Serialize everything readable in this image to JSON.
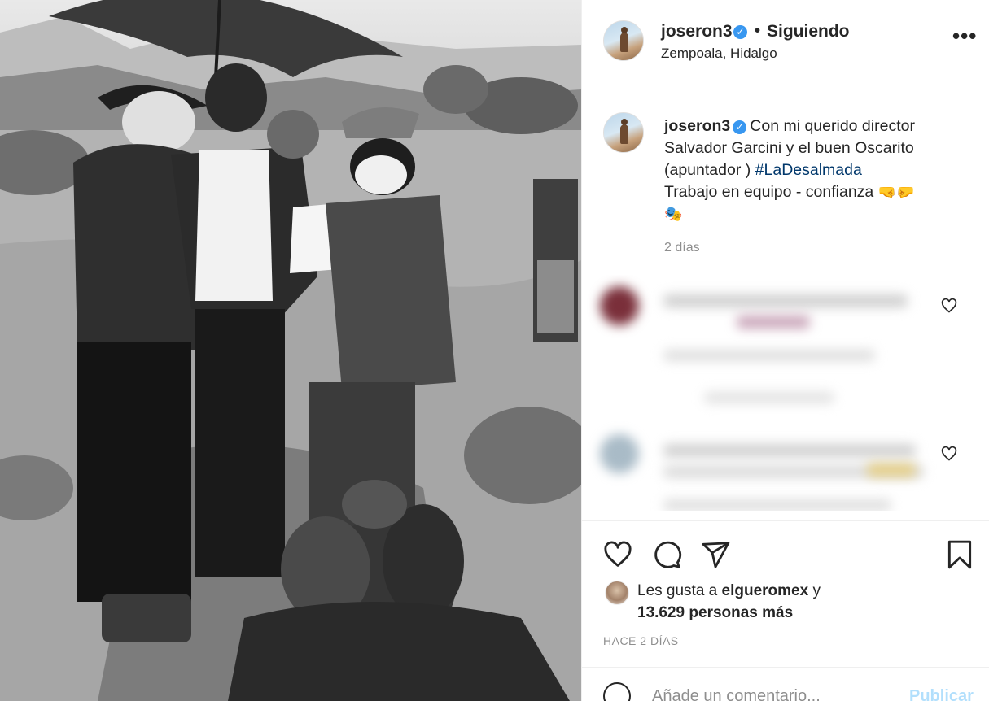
{
  "post": {
    "username": "joseron3",
    "follow_status": "Siguiendo",
    "separator": "•",
    "location": "Zempoala, Hidalgo",
    "more_label": "•••",
    "verified_mark": "✓"
  },
  "caption": {
    "username": "joseron3",
    "text_1": "Con mi querido director Salvador Garcini y el buen Oscarito (apuntador ) ",
    "hashtag": "#LaDesalmada",
    "text_2": "Trabajo en equipo - confianza",
    "emoji_1": "🤜🤛",
    "emoji_2": "🎭",
    "time": "2 días"
  },
  "actions": {
    "icons": [
      "heart-icon",
      "comment-icon",
      "share-icon",
      "bookmark-icon"
    ]
  },
  "likes": {
    "prefix": "Les gusta a ",
    "user": "elgueromex",
    "suffix": " y",
    "others": "13.629 personas más"
  },
  "posted": "HACE 2 DÍAS",
  "comment_box": {
    "placeholder": "Añade un comentario...",
    "publish_label": "Publicar"
  },
  "colors": {
    "verified": "#3897f0",
    "hashtag": "#00376b",
    "muted": "#8e8e8e",
    "publish_disabled": "#b2dffc"
  }
}
